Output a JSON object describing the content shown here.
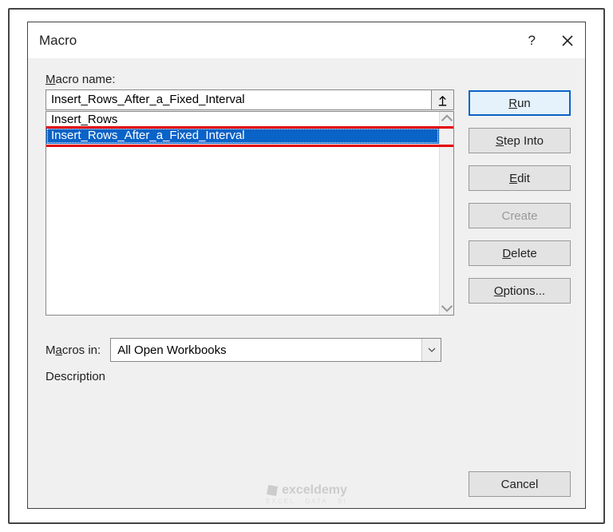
{
  "dialog": {
    "title": "Macro",
    "help_tooltip": "?",
    "close_tooltip": "Close"
  },
  "labels": {
    "macro_name": "Macro name:",
    "macros_in": "Macros in:",
    "description": "Description"
  },
  "macro_name_input": "Insert_Rows_After_a_Fixed_Interval",
  "macro_list": {
    "items": [
      {
        "label": "Insert_Rows",
        "selected": false
      },
      {
        "label": "Insert_Rows_After_a_Fixed_Interval",
        "selected": true
      }
    ]
  },
  "macros_in_select": {
    "value": "All Open Workbooks"
  },
  "buttons": {
    "run": "Run",
    "step_into": "Step Into",
    "edit": "Edit",
    "create": "Create",
    "delete": "Delete",
    "options": "Options...",
    "cancel": "Cancel"
  },
  "watermark": {
    "brand": "exceldemy",
    "sub": "EXCEL · DATA · BI"
  }
}
